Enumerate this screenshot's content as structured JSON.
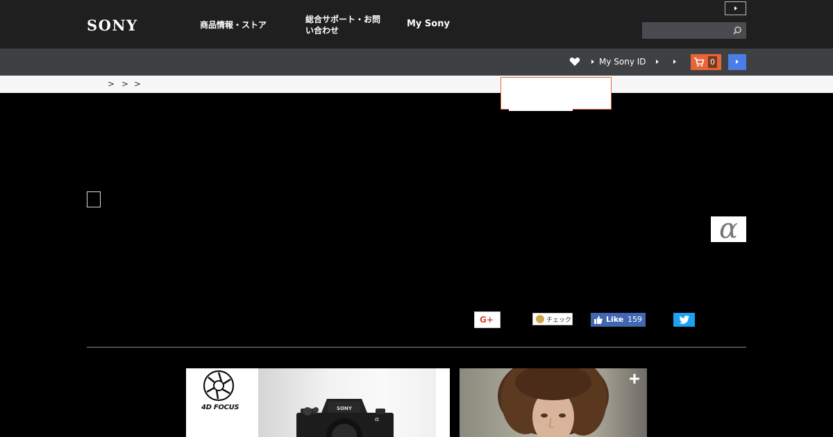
{
  "brand": {
    "logo": "SONY"
  },
  "nav": {
    "products": "商品情報・ストア",
    "support": "総合サポート・お問い合わせ",
    "mysony": "My Sony"
  },
  "search": {
    "value": "",
    "placeholder": ""
  },
  "utility": {
    "mysonyid": "My Sony ID",
    "cart_count": "0"
  },
  "breadcrumb": [
    ">",
    ">",
    ">"
  ],
  "social": {
    "gplus": "G+",
    "mixi": "チェック",
    "facebook_like": "Like",
    "facebook_count": "159"
  },
  "brand_mark": "α",
  "features": {
    "card1_label": "4D FOCUS",
    "camera_brand": "SONY"
  },
  "colors": {
    "topnav_bg": "#1f1f1f",
    "utilbar_bg": "#3f4044",
    "cart_orange": "#e8643a",
    "login_blue": "#4a7ee6",
    "facebook_blue": "#4267b2",
    "twitter_blue": "#1da1f2"
  }
}
